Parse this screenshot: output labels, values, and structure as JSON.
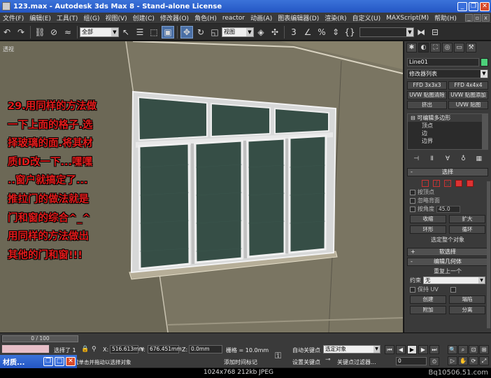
{
  "window": {
    "title": "123.max - Autodesk 3ds Max 8 - Stand-alone License"
  },
  "menu": {
    "items": [
      "文件(F)",
      "编辑(E)",
      "工具(T)",
      "组(G)",
      "视图(V)",
      "创建(C)",
      "修改器(O)",
      "角色(H)",
      "reactor",
      "动画(A)",
      "图表编辑器(D)",
      "渲染(R)",
      "自定义(U)",
      "MAXScript(M)",
      "帮助(H)"
    ]
  },
  "toolbar": {
    "selection_filter": "全部",
    "ref_coord": "视图"
  },
  "viewport": {
    "label": "透视",
    "annotation": [
      "29.用同样的方法做",
      "一下上面的格子.选",
      "择玻璃的面.将其材",
      "质ID改一下...嘿嘿",
      "..窗户就搞定了...",
      "推拉门的做法就是",
      "门和窗的综合^_^",
      "用同样的方法做出",
      "其他的门和窗!!!"
    ]
  },
  "command_panel": {
    "object_name": "Line01",
    "object_color": "#4cd07a",
    "modifier_list": "修改器列表",
    "modifier_buttons": [
      "FFD 3x3x3",
      "FFD 4x4x4",
      "UVW 贴图清除",
      "UVW 贴图添加",
      "挤出",
      "UVW 贴图"
    ],
    "stack": {
      "root": "可编辑多边形",
      "items": [
        "顶点",
        "边",
        "边界"
      ]
    },
    "selection": {
      "title": "选择",
      "by_vertex": "按顶点",
      "ignore_backfacing": "忽略背面",
      "by_angle": "按角度",
      "angle_value": "45.0",
      "shrink": "收缩",
      "grow": "扩大",
      "ring": "环形",
      "loop": "循环",
      "status": "选定整个对象"
    },
    "soft_selection": {
      "title": "软选择"
    },
    "edit_geometry": {
      "title": "编辑几何体",
      "repeat_last": "重复上一个",
      "constraints_label": "约束",
      "constraints_value": "无",
      "preserve_uvs": "保持 UV",
      "create": "创建",
      "collapse": "塌陷",
      "attach": "附加",
      "detach": "分离"
    }
  },
  "timeline": {
    "frame": "0 / 100"
  },
  "status": {
    "selected": "选择了 1",
    "prompt": "单击或单击并拖动以选择对象",
    "x": "516.613mm",
    "y": "676.451mm",
    "z": "0.0mm",
    "grid": "栅格 = 10.0mm",
    "add_time_tag": "添加时间标记",
    "auto_key": "自动关键点",
    "set_key": "设置关键点",
    "key_mode": "选定对象",
    "key_filters": "关键点过滤器...",
    "frame_field": "0"
  },
  "taskbar": {
    "title": "材质..."
  },
  "footer": {
    "info": "1024x768  212kb  JPEG",
    "watermark": "Bq10506.51.com"
  }
}
